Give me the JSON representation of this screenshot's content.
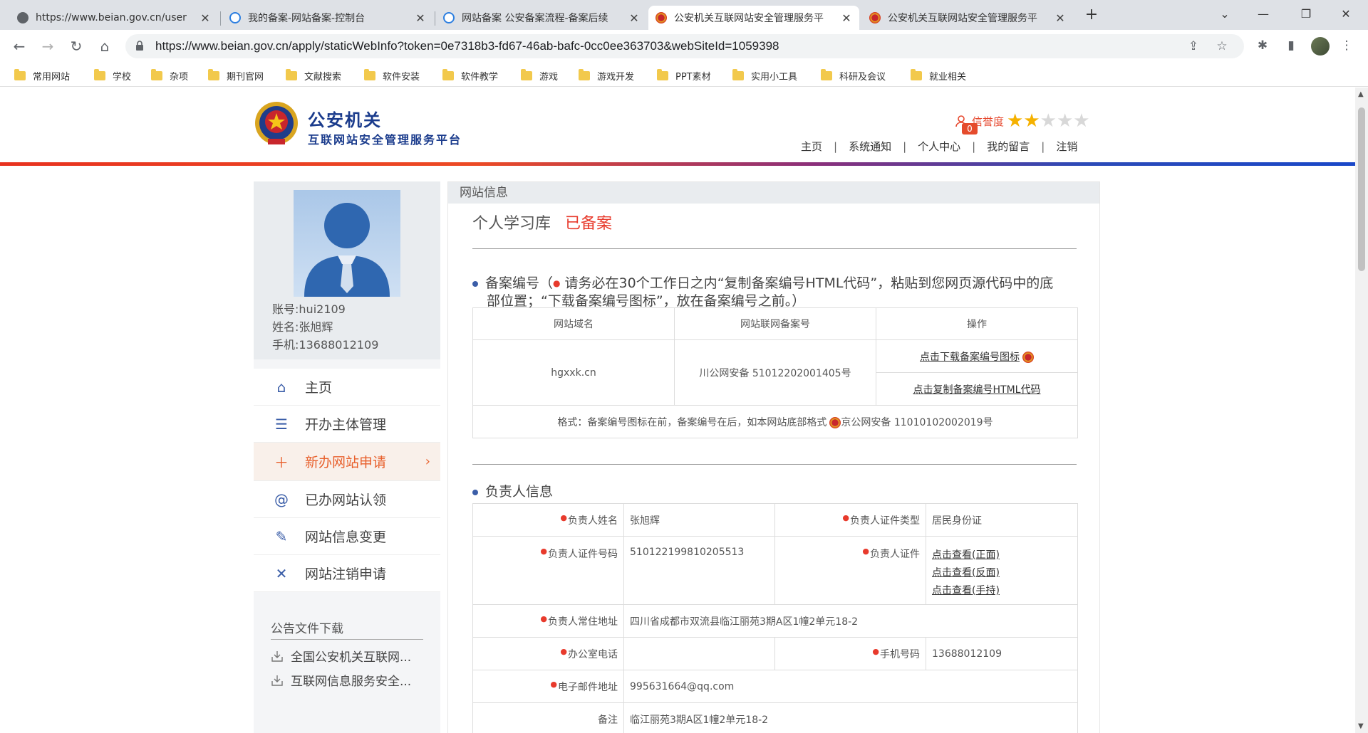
{
  "browser": {
    "tabs": [
      {
        "title": "https://www.beian.gov.cn/user",
        "icon": "globe-icon"
      },
      {
        "title": "我的备案-网站备案-控制台",
        "icon": "cloud-icon"
      },
      {
        "title": "网站备案 公安备案流程-备案后续",
        "icon": "cloud-icon"
      },
      {
        "title": "公安机关互联网站安全管理服务平",
        "icon": "police-emblem-icon"
      },
      {
        "title": "公安机关互联网站安全管理服务平",
        "icon": "police-emblem-icon"
      }
    ],
    "active_tab": 3,
    "url": "https://www.beian.gov.cn/apply/staticWebInfo?token=0e7318b3-fd67-46ab-bafc-0cc0ee363703&webSiteId=1059398",
    "bookmarks": [
      "常用网站",
      "学校",
      "杂项",
      "期刊官网",
      "文献搜索",
      "软件安装",
      "软件教学",
      "游戏",
      "游戏开发",
      "PPT素材",
      "实用小工具",
      "科研及会议",
      "就业相关"
    ]
  },
  "header": {
    "title": "公安机关",
    "subtitle": "互联网站安全管理服务平台",
    "credit_label": "信誉度",
    "credit_stars": 2,
    "credit_max": 5,
    "badge_count": "0",
    "nav": [
      "主页",
      "系统通知",
      "个人中心",
      "我的留言",
      "注销"
    ]
  },
  "profile": {
    "account_label": "账号:",
    "account": "hui2109",
    "name_label": "姓名:",
    "name": "张旭辉",
    "phone_label": "手机:",
    "phone": "13688012109"
  },
  "menu": [
    {
      "label": "主页",
      "icon": "home-icon"
    },
    {
      "label": "开办主体管理",
      "icon": "list-icon"
    },
    {
      "label": "新办网站申请",
      "icon": "plus-icon",
      "active": true
    },
    {
      "label": "已办网站认领",
      "icon": "at-icon"
    },
    {
      "label": "网站信息变更",
      "icon": "edit-icon"
    },
    {
      "label": "网站注销申请",
      "icon": "close-icon"
    }
  ],
  "notices": {
    "title": "公告文件下载",
    "items": [
      "全国公安机关互联网...",
      "互联网信息服务安全..."
    ]
  },
  "main": {
    "panel_title": "网站信息",
    "site_name": "个人学习库",
    "site_status": "已备案",
    "record_section": {
      "title_prefix": "备案编号（",
      "title_rest": " 请务必在30个工作日之内“复制备案编号HTML代码”，粘贴到您网页源代码中的底",
      "title_line2": "部位置；“下载备案编号图标”，放在备案编号之前。）",
      "headers": [
        "网站域名",
        "网站联网备案号",
        "操作"
      ],
      "domain": "hgxxk.cn",
      "record_no": "川公网安备 51012202001405号",
      "action_download": "点击下载备案编号图标",
      "action_copy": "点击复制备案编号HTML代码",
      "format_text": "格式：备案编号图标在前，备案编号在后，如本网站底部格式",
      "format_example": "京公网安备 11010102002019号"
    },
    "owner_section": {
      "title": "负责人信息",
      "name_label": "负责人姓名",
      "name": "张旭辉",
      "id_type_label": "负责人证件类型",
      "id_type": "居民身份证",
      "id_no_label": "负责人证件号码",
      "id_no": "510122199810205513",
      "id_doc_label": "负责人证件",
      "id_doc_links": [
        "点击查看(正面)",
        "点击查看(反面)",
        "点击查看(手持)"
      ],
      "address_label": "负责人常住地址",
      "address": "四川省成都市双流县临江丽苑3期A区1幢2单元18-2",
      "office_phone_label": "办公室电话",
      "office_phone": "",
      "mobile_label": "手机号码",
      "mobile": "13688012109",
      "email_label": "电子邮件地址",
      "email": "995631664@qq.com",
      "remark_label": "备注",
      "remark": "临江丽苑3期A区1幢2单元18-2"
    }
  }
}
